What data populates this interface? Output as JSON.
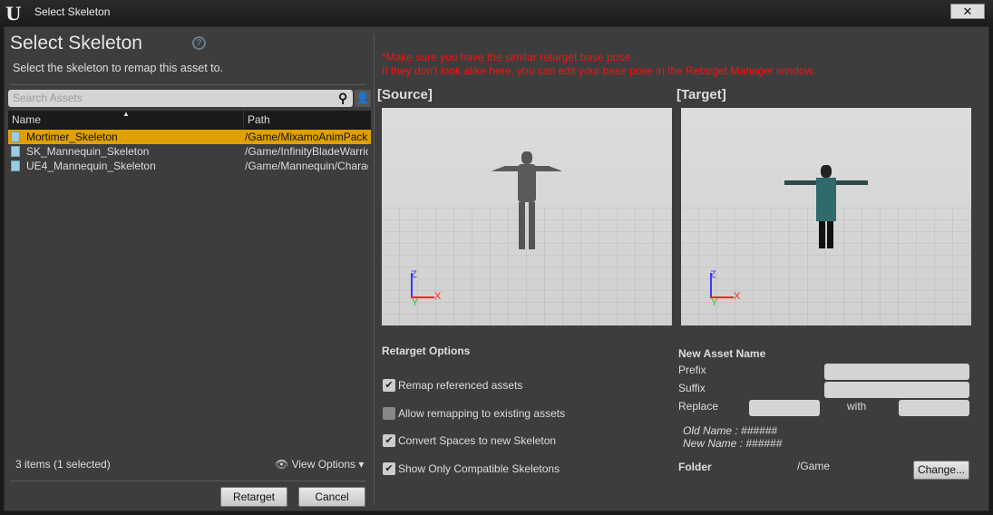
{
  "window": {
    "title": "Select Skeleton",
    "logo": "U",
    "close": "✕"
  },
  "left": {
    "heading": "Select Skeleton",
    "help": "?",
    "subtitle": "Select the skeleton to remap this asset to.",
    "search_placeholder": "Search Assets",
    "columns": {
      "name": "Name",
      "path": "Path"
    },
    "rows": [
      {
        "name": "Mortimer_Skeleton",
        "path": "/Game/MixamoAnimPack",
        "selected": true
      },
      {
        "name": "SK_Mannequin_Skeleton",
        "path": "/Game/InfinityBladeWarriors",
        "selected": false
      },
      {
        "name": "UE4_Mannequin_Skeleton",
        "path": "/Game/Mannequin/Character",
        "selected": false
      }
    ],
    "count": "3 items (1 selected)",
    "view_options": "View Options",
    "retarget": "Retarget",
    "cancel": "Cancel"
  },
  "right": {
    "warning1": "*Make sure you have the similar retarget base pose.",
    "warning2": "If they don't look alike here, you can edit your base pose in the Retarget Manager window.",
    "source": "[Source]",
    "target": "[Target]",
    "axes": {
      "z": "Z",
      "x": "X",
      "y": "Y"
    },
    "options_title": "Retarget Options",
    "options": [
      {
        "label": "Remap referenced assets",
        "checked": true
      },
      {
        "label": "Allow remapping to existing assets",
        "checked": false
      },
      {
        "label": "Convert Spaces to new Skeleton",
        "checked": true
      },
      {
        "label": "Show Only Compatible Skeletons",
        "checked": true
      }
    ],
    "new_asset": {
      "title": "New Asset Name",
      "prefix": "Prefix",
      "suffix": "Suffix",
      "replace": "Replace",
      "with": "with",
      "old_name": "Old Name : ######",
      "new_name": "New Name : ######",
      "folder": "Folder",
      "folder_value": "/Game",
      "change": "Change..."
    }
  }
}
